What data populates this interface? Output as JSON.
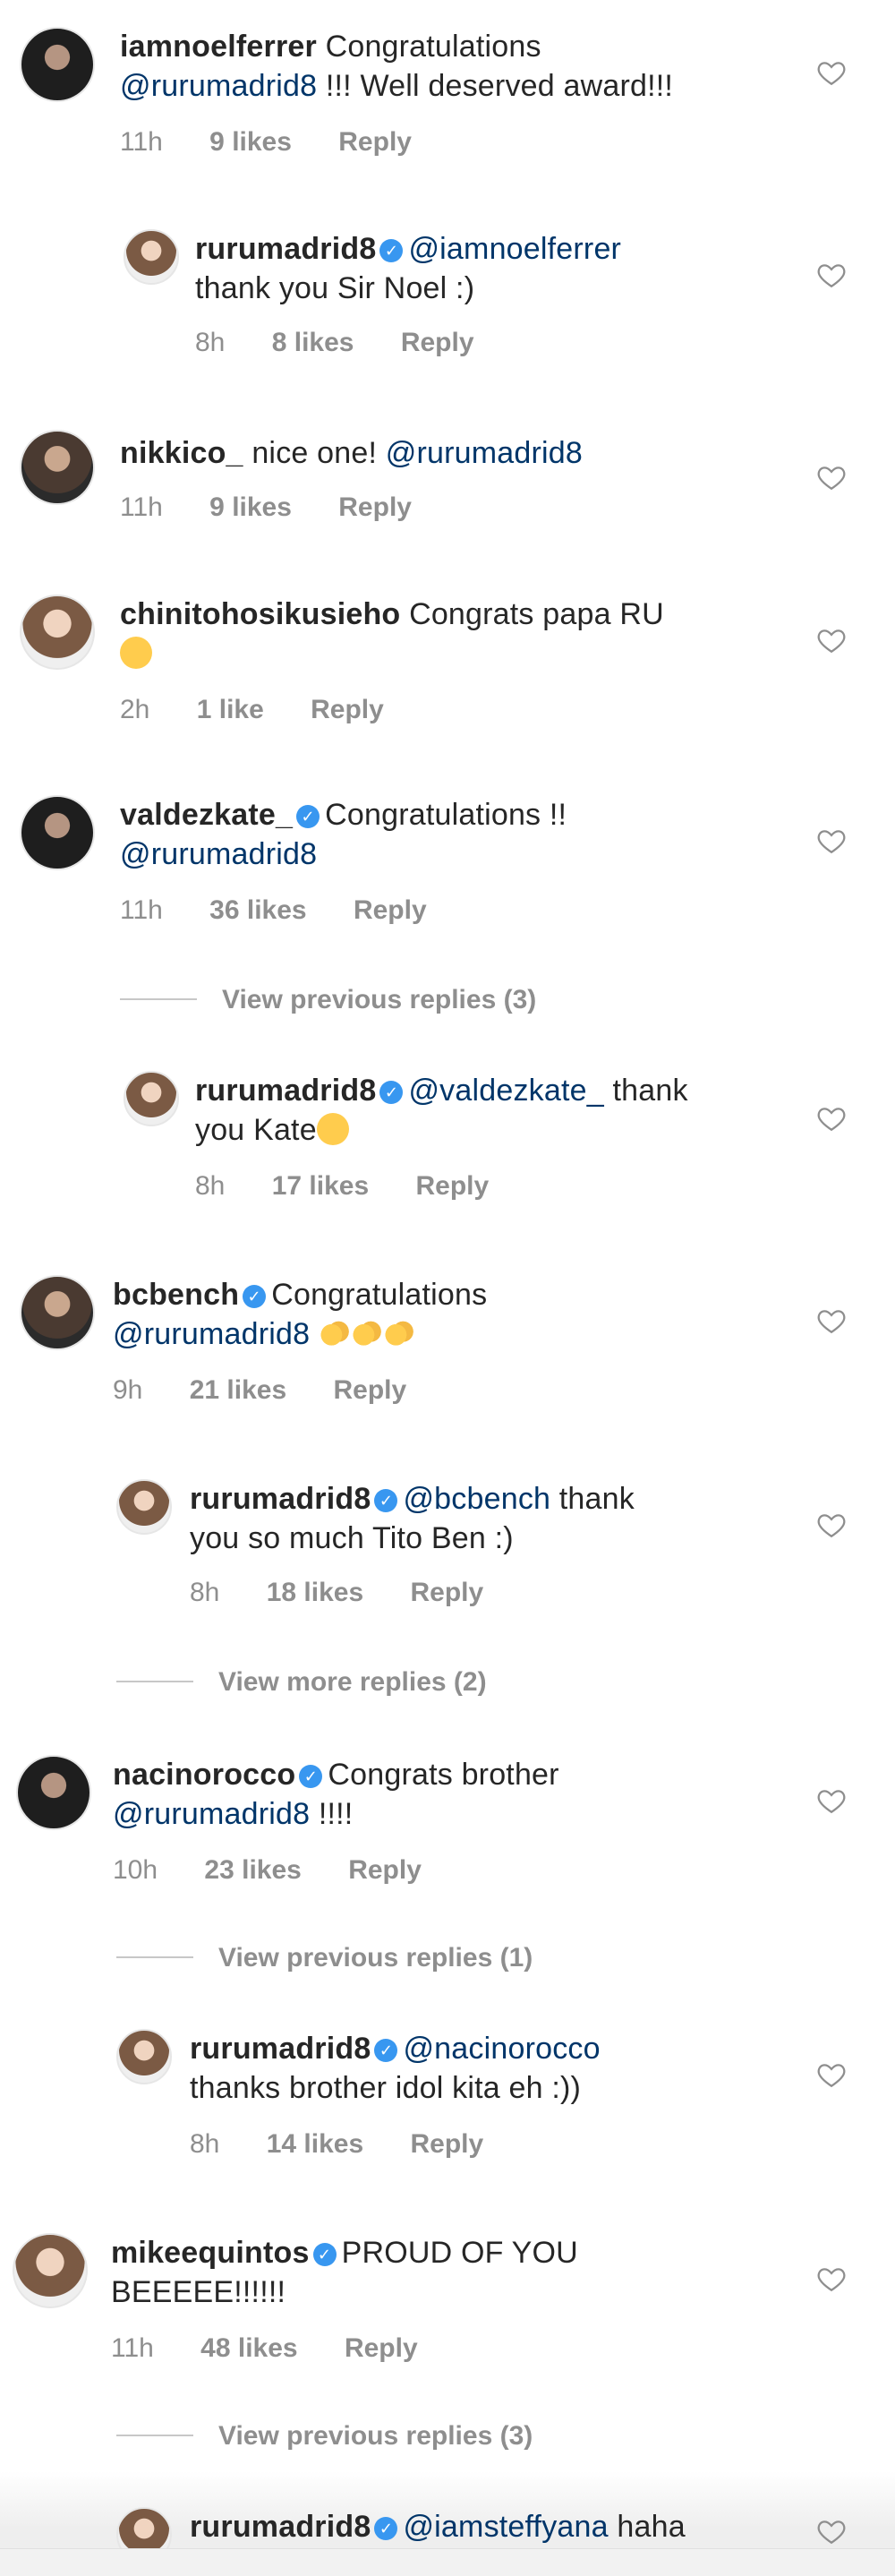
{
  "comments": [
    {
      "user": "iamnoelferrer",
      "text1": "Congratulations",
      "mention2": "@rurumadrid8",
      "text2": " !!! Well deserved award!!!",
      "time": "11h",
      "likes": "9 likes",
      "reply": "Reply"
    },
    {
      "user": "rurumadrid8",
      "mention1": "@iamnoelferrer",
      "text2": "thank you Sir Noel :)",
      "time": "8h",
      "likes": "8 likes",
      "reply": "Reply"
    },
    {
      "user": "nikkico_",
      "text1": "nice one!",
      "mention1": "@rurumadrid8",
      "time": "11h",
      "likes": "9 likes",
      "reply": "Reply"
    },
    {
      "user": "chinitohosikusieho",
      "text1": "Congrats papa RU",
      "time": "2h",
      "likes": "1 like",
      "reply": "Reply"
    },
    {
      "user": "valdezkate_",
      "text1": "Congratulations !!",
      "mention2": "@rurumadrid8",
      "time": "11h",
      "likes": "36 likes",
      "reply": "Reply"
    },
    {
      "user": "rurumadrid8",
      "mention1": "@valdezkate_",
      "text1": " thank",
      "text2": "you Kate",
      "time": "8h",
      "likes": "17 likes",
      "reply": "Reply"
    },
    {
      "user": "bcbench",
      "text1": "Congratulations",
      "mention2": "@rurumadrid8",
      "time": "9h",
      "likes": "21 likes",
      "reply": "Reply"
    },
    {
      "user": "rurumadrid8",
      "mention1": "@bcbench",
      "text1": " thank",
      "text2": "you so much Tito Ben :)",
      "time": "8h",
      "likes": "18 likes",
      "reply": "Reply"
    },
    {
      "user": "nacinorocco",
      "text1": "Congrats brother",
      "mention2": "@rurumadrid8",
      "text2": " !!!!",
      "time": "10h",
      "likes": "23 likes",
      "reply": "Reply"
    },
    {
      "user": "rurumadrid8",
      "mention1": "@nacinorocco",
      "text2": "thanks brother idol kita eh :))",
      "time": "8h",
      "likes": "14 likes",
      "reply": "Reply"
    },
    {
      "user": "mikeequintos",
      "text1": "PROUD OF YOU",
      "text2": "BEEEEE!!!!!!",
      "time": "11h",
      "likes": "48 likes",
      "reply": "Reply"
    },
    {
      "user": "rurumadrid8",
      "mention1": "@iamsteffyana",
      "text1": " haha"
    }
  ],
  "view_more": [
    "View previous replies (3)",
    "View more replies (2)",
    "View previous replies (1)",
    "View previous replies (3)"
  ],
  "colors": {
    "mention": "#003569",
    "verified": "#3897f0",
    "meta": "#8e8e8e"
  }
}
